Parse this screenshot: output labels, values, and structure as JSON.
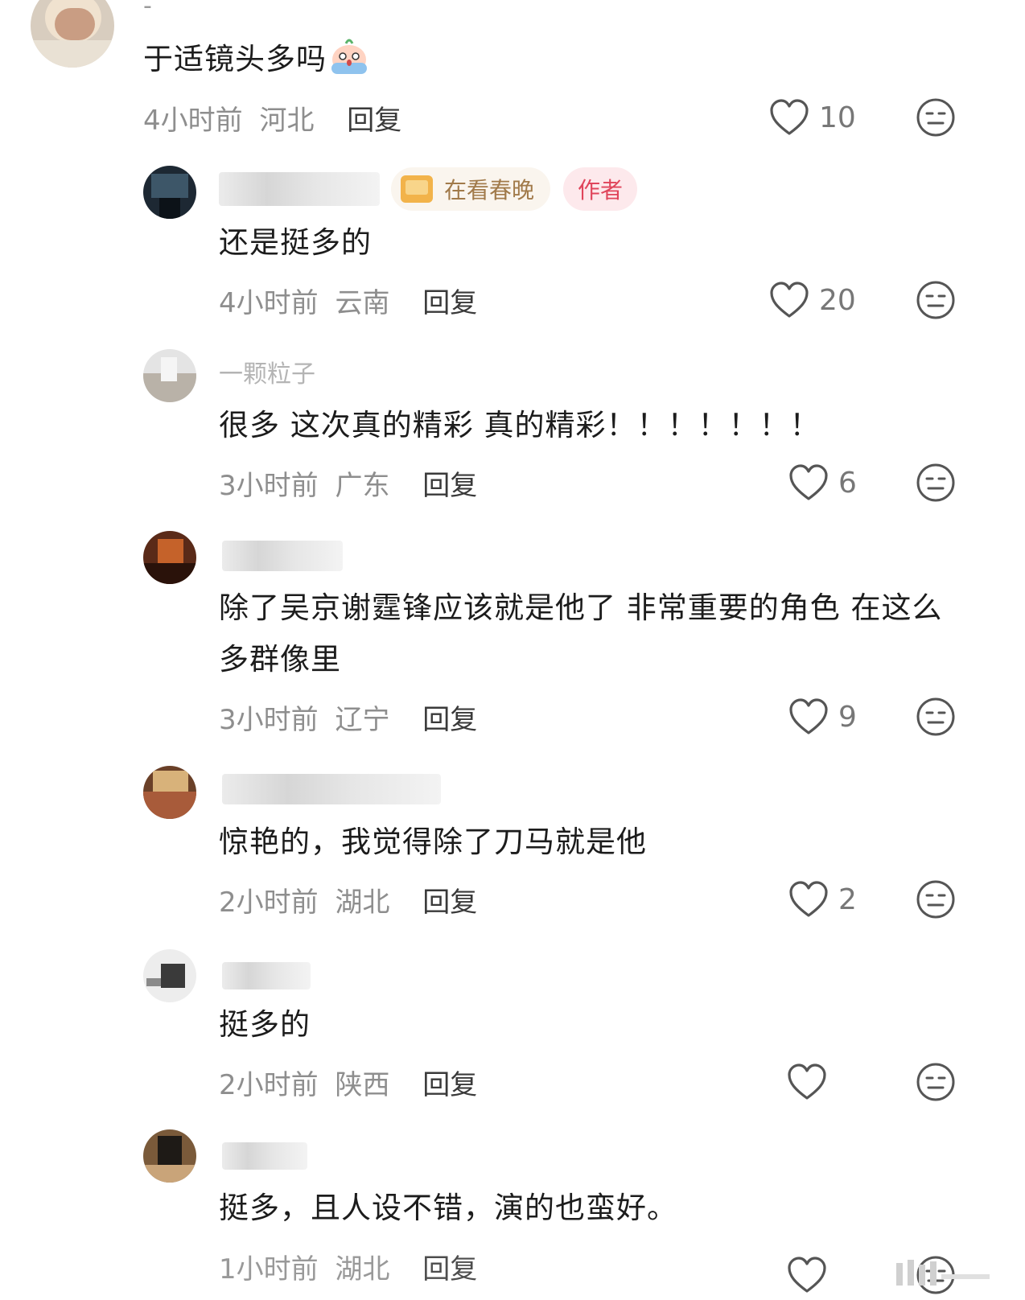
{
  "comments": [
    {
      "username": "-",
      "text": "于适镜头多吗",
      "time": "4小时前",
      "location": "河北",
      "reply": "回复",
      "likes": "10",
      "badges": []
    },
    {
      "username": "",
      "text": "还是挺多的",
      "time": "4小时前",
      "location": "云南",
      "reply": "回复",
      "likes": "20",
      "badges": [
        "在看春晚",
        "作者"
      ]
    },
    {
      "username": "一颗粒子",
      "text": "很多 这次真的精彩 真的精彩！！！！！！！",
      "time": "3小时前",
      "location": "广东",
      "reply": "回复",
      "likes": "6",
      "badges": []
    },
    {
      "username": "",
      "text": "除了吴京谢霆锋应该就是他了 非常重要的角色 在这么多群像里",
      "time": "3小时前",
      "location": "辽宁",
      "reply": "回复",
      "likes": "9",
      "badges": []
    },
    {
      "username": "",
      "text": "惊艳的，我觉得除了刀马就是他",
      "time": "2小时前",
      "location": "湖北",
      "reply": "回复",
      "likes": "2",
      "badges": []
    },
    {
      "username": "",
      "text": "挺多的",
      "time": "2小时前",
      "location": "陕西",
      "reply": "回复",
      "likes": "",
      "badges": []
    },
    {
      "username": "",
      "text": "挺多，且人设不错，演的也蛮好。",
      "time": "1小时前",
      "location": "湖北",
      "reply": "回复",
      "likes": "",
      "badges": []
    }
  ],
  "icons": {
    "like": "heart-outline-icon",
    "dislike": "unamused-face-icon",
    "emoji": "crying-face-emoji"
  },
  "colors": {
    "author_badge_bg": "#fde9ec",
    "author_badge_text": "#e0455b",
    "watch_badge_bg": "#faf5ee",
    "watch_badge_text": "#a17a4a",
    "meta_text": "#8e8e8e"
  }
}
